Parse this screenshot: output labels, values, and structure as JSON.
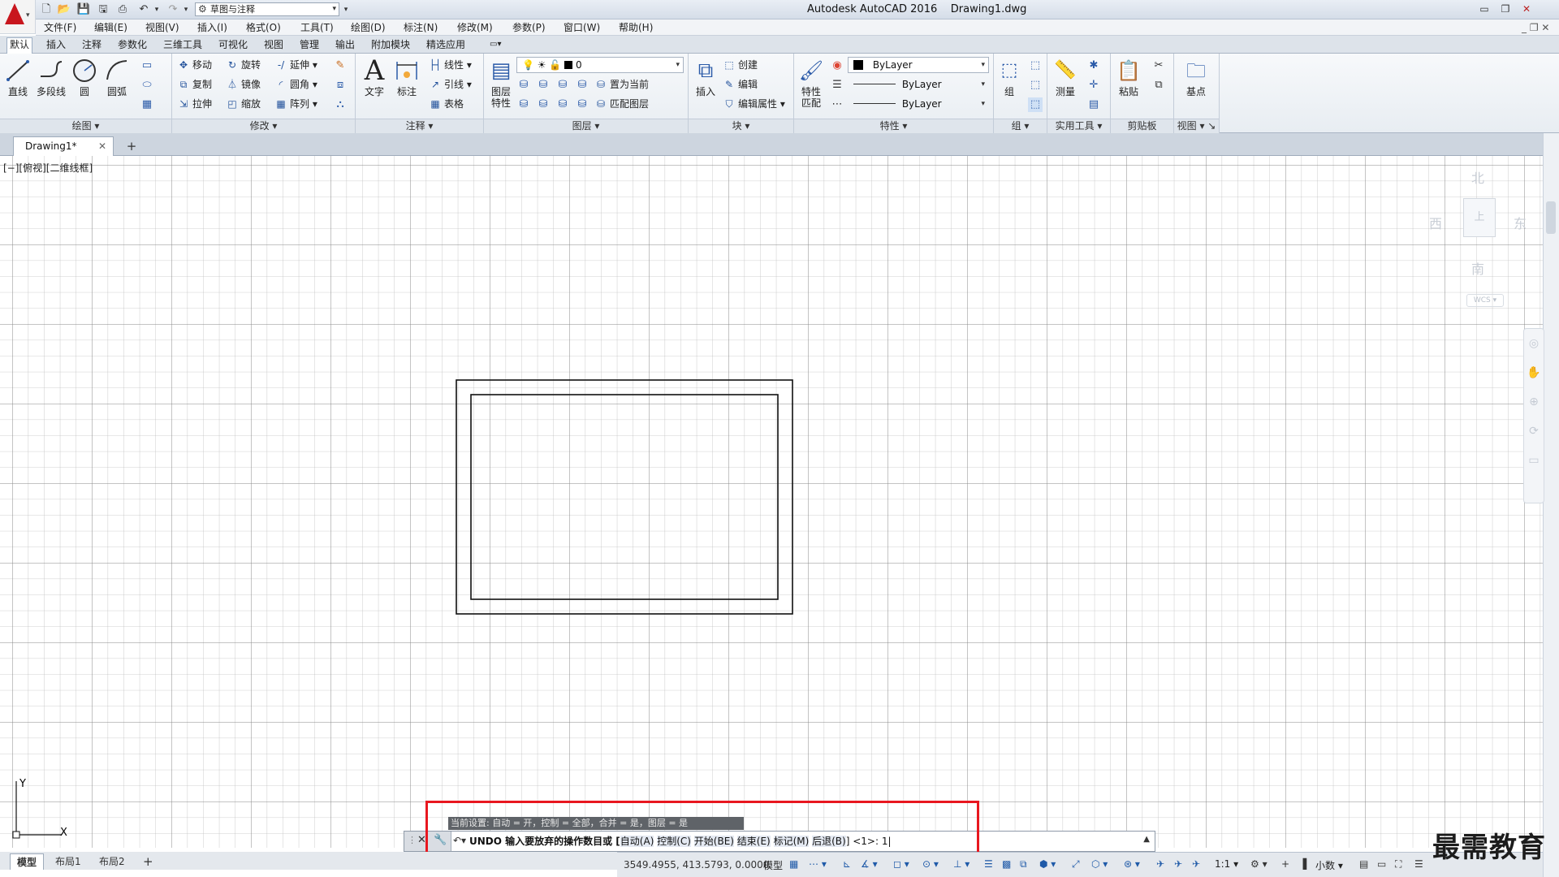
{
  "app": {
    "title": "Autodesk AutoCAD 2016    Drawing1.dwg",
    "workspace": "草图与注释"
  },
  "menubar": [
    "文件(F)",
    "编辑(E)",
    "视图(V)",
    "插入(I)",
    "格式(O)",
    "工具(T)",
    "绘图(D)",
    "标注(N)",
    "修改(M)",
    "参数(P)",
    "窗口(W)",
    "帮助(H)"
  ],
  "ribbon_tabs": [
    "默认",
    "插入",
    "注释",
    "参数化",
    "三维工具",
    "可视化",
    "视图",
    "管理",
    "输出",
    "附加模块",
    "精选应用"
  ],
  "ribbon": {
    "draw": {
      "title": "绘图",
      "line": "直线",
      "polyline": "多段线",
      "circle": "圆",
      "arc": "圆弧"
    },
    "modify": {
      "title": "修改",
      "move": "移动",
      "rotate": "旋转",
      "trim": "延伸",
      "copy": "复制",
      "mirror": "镜像",
      "fillet": "圆角",
      "stretch": "拉伸",
      "scale": "缩放",
      "array": "阵列"
    },
    "annotation": {
      "title": "注释",
      "text": "文字",
      "dimension": "标注",
      "linear": "线性",
      "leader": "引线",
      "table": "表格"
    },
    "layers": {
      "title": "图层",
      "properties": "图层\n特性",
      "layer_value": "0",
      "make_current": "置为当前",
      "match_layer": "匹配图层"
    },
    "block": {
      "title": "块",
      "insert": "插入",
      "create": "创建",
      "edit": "编辑",
      "edit_attr": "编辑属性"
    },
    "properties": {
      "title": "特性",
      "match": "特性\n匹配",
      "color": "ByLayer",
      "linetype": "ByLayer",
      "lineweight": "ByLayer"
    },
    "groups": {
      "title": "组",
      "group": "组"
    },
    "utilities": {
      "title": "实用工具",
      "measure": "测量"
    },
    "clipboard": {
      "title": "剪贴板",
      "paste": "粘贴"
    },
    "view": {
      "title": "视图",
      "base": "基点"
    }
  },
  "doc_tab": {
    "label": "Drawing1*"
  },
  "viewport_label": "[−][俯视][二维线框]",
  "viewcube": {
    "north": "北",
    "south": "南",
    "east": "东",
    "west": "西",
    "top": "上",
    "wcs": "WCS"
  },
  "ucs": {
    "y": "Y",
    "x": "X"
  },
  "command": {
    "history": "当前设置: 自动 = 开，控制 = 全部，合并 = 是，图层 = 是",
    "prompt_main": "UNDO 输入要放弃的操作数目或 [",
    "options": [
      "自动(A)",
      "控制(C)",
      "开始(BE)",
      "结束(E)",
      "标记(M)",
      "后退(B)"
    ],
    "prompt_end": "] <1>: ",
    "input_value": "1"
  },
  "layout_tabs": [
    "模型",
    "布局1",
    "布局2"
  ],
  "status": {
    "coords": "3549.4955, 413.5793, 0.0000",
    "model": "模型",
    "scale": "1:1",
    "units": "小数"
  },
  "watermark": "最需教育"
}
